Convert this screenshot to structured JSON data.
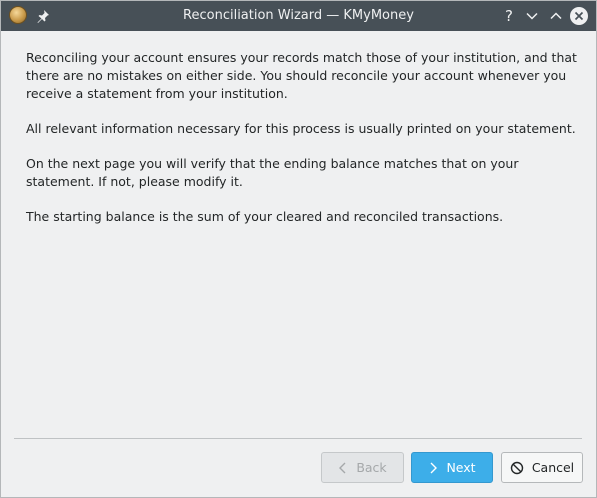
{
  "window": {
    "title": "Reconciliation Wizard — KMyMoney",
    "icons": {
      "app": "kmymoney-app-icon",
      "pin": "pin-icon",
      "help": "help-icon",
      "minimize": "minimize-icon",
      "maximize": "maximize-icon",
      "close": "close-icon"
    },
    "help_glyph": "?"
  },
  "content": {
    "paragraphs": [
      "Reconciling your account ensures your records match those of your institution, and that there are no mistakes on either side. You should reconcile your account whenever you receive a statement from your institution.",
      "All relevant information necessary for this process is usually printed on your statement.",
      "On the next page you will verify that the ending balance matches that on your statement. If not, please modify it.",
      "The starting balance is the sum of your cleared and reconciled transactions."
    ]
  },
  "buttons": {
    "back": {
      "label": "Back",
      "icon": "chevron-left-icon",
      "enabled": false
    },
    "next": {
      "label": "Next",
      "icon": "chevron-right-icon",
      "enabled": true
    },
    "cancel": {
      "label": "Cancel",
      "icon": "cancel-icon",
      "enabled": true
    }
  },
  "colors": {
    "titlebar": "#475057",
    "window_bg": "#eff0f1",
    "accent": "#3daee9",
    "text": "#232627",
    "disabled_text": "#a5a8aa"
  }
}
